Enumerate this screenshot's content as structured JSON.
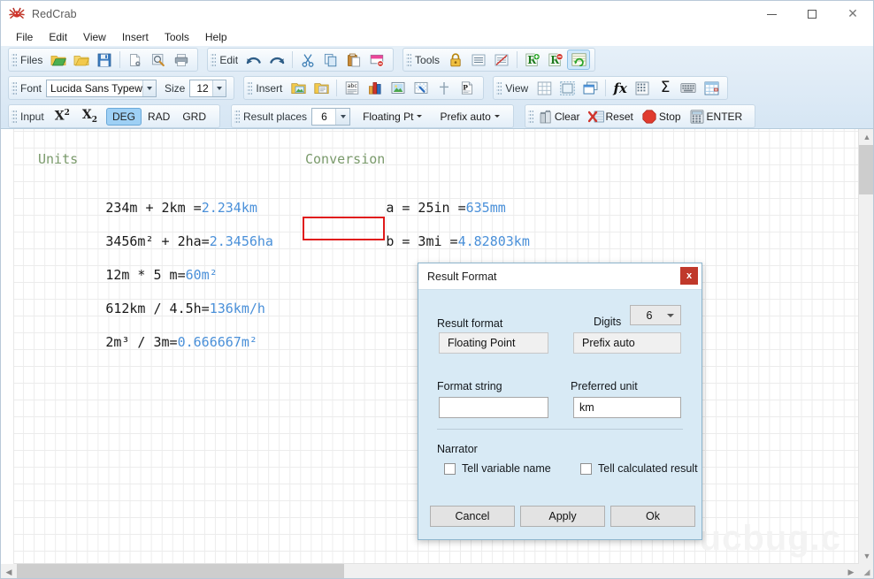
{
  "window": {
    "title": "RedCrab",
    "app_icon": "redcrab-icon",
    "minimize": "minimize-icon",
    "maximize": "maximize-icon",
    "close": "close-icon"
  },
  "menu": {
    "items": [
      "File",
      "Edit",
      "View",
      "Insert",
      "Tools",
      "Help"
    ]
  },
  "toolbars": {
    "files": {
      "label": "Files",
      "buttons": [
        {
          "name": "open-folder-green-icon",
          "glyph": "📂"
        },
        {
          "name": "open-folder-yellow-icon",
          "glyph": "📁"
        },
        {
          "name": "save-icon",
          "glyph": "💾"
        },
        {
          "name": "page-setup-icon",
          "glyph": "📄"
        },
        {
          "name": "print-preview-icon",
          "glyph": "🔍"
        },
        {
          "name": "print-icon",
          "glyph": "🖨"
        }
      ]
    },
    "edit": {
      "label": "Edit",
      "buttons": [
        {
          "name": "undo-icon",
          "glyph": "↶"
        },
        {
          "name": "redo-icon",
          "glyph": "↷"
        },
        {
          "name": "cut-icon",
          "glyph": "✂"
        },
        {
          "name": "copy-icon",
          "glyph": "⧉"
        },
        {
          "name": "paste-icon",
          "glyph": "📋"
        },
        {
          "name": "delete-icon",
          "glyph": "⊖"
        }
      ]
    },
    "tools": {
      "label": "Tools",
      "buttons": [
        {
          "name": "lock-icon",
          "glyph": "🔒"
        },
        {
          "name": "align-lines-icon",
          "glyph": "☰"
        },
        {
          "name": "no-lines-icon",
          "glyph": "⊘"
        },
        {
          "name": "add-result-icon",
          "glyph": "R+"
        },
        {
          "name": "remove-result-icon",
          "glyph": "R-"
        },
        {
          "name": "recalculate-icon",
          "glyph": "↻"
        }
      ]
    },
    "font": {
      "label": "Font",
      "font_value": "Lucida Sans Typewri",
      "size_label": "Size",
      "size_value": "12"
    },
    "insert": {
      "label": "Insert",
      "buttons": [
        {
          "name": "insert-image-icon",
          "glyph": "🖼"
        },
        {
          "name": "insert-document-icon",
          "glyph": "📑"
        },
        {
          "name": "insert-text-icon",
          "glyph": "abc"
        },
        {
          "name": "insert-chart-icon",
          "glyph": "📊"
        },
        {
          "name": "insert-picture-icon",
          "glyph": "🖼"
        },
        {
          "name": "insert-transparent-icon",
          "glyph": "▨"
        },
        {
          "name": "insert-separator-icon",
          "glyph": "┼"
        },
        {
          "name": "insert-pdf-icon",
          "glyph": "P"
        }
      ]
    },
    "view": {
      "label": "View",
      "buttons": [
        {
          "name": "grid-icon",
          "glyph": "⊞"
        },
        {
          "name": "page-border-icon",
          "glyph": "▢"
        },
        {
          "name": "windows-icon",
          "glyph": "⧉"
        },
        {
          "name": "function-icon",
          "glyph": "fx"
        },
        {
          "name": "matrix-icon",
          "glyph": "⌸"
        },
        {
          "name": "sum-icon",
          "glyph": "Σ"
        },
        {
          "name": "keyboard-icon",
          "glyph": "⌨"
        },
        {
          "name": "table-icon",
          "glyph": "▦"
        }
      ]
    },
    "input": {
      "label": "Input",
      "superscript": "X2",
      "subscript": "X2",
      "angle_modes": [
        "DEG",
        "RAD",
        "GRD"
      ],
      "angle_selected": "DEG"
    },
    "result": {
      "places_label": "Result places",
      "places_value": "6",
      "format_label": "Floating Pt",
      "prefix_label": "Prefix auto"
    },
    "actions": {
      "clear": "Clear",
      "reset": "Reset",
      "stop": "Stop",
      "enter": "ENTER",
      "clear_icon": "trash-icon",
      "reset_icon": "reset-red-x-icon",
      "stop_icon": "stop-octagon-icon",
      "enter_icon": "calculator-icon"
    }
  },
  "document": {
    "watermark": "ucbug.c",
    "columns": [
      {
        "name": "units-column",
        "header": "Units",
        "lines": [
          {
            "expr": "234m + 2km =",
            "result": "2.234km"
          },
          {
            "expr": "3456m² + 2ha=",
            "result": "2.3456ha"
          },
          {
            "expr": "12m * 5 m=",
            "result": "60m²"
          },
          {
            "expr": "612km / 4.5h=",
            "result": "136km/h"
          },
          {
            "expr": "2m³ / 3m=",
            "result": "0.666667m²"
          }
        ]
      },
      {
        "name": "conversion-column",
        "header": "Conversion",
        "lines": [
          {
            "expr": "a = 25in =",
            "result": "635mm",
            "selected": false
          },
          {
            "expr": "b = 3mi =",
            "result": "4.82803km",
            "selected": true
          }
        ]
      }
    ]
  },
  "dialog": {
    "title": "Result Format",
    "close_label": "x",
    "result_format_label": "Result format",
    "result_format_value": "Floating Point",
    "digits_label": "Digits",
    "digits_value": "6",
    "prefix_value": "Prefix auto",
    "format_string_label": "Format string",
    "format_string_value": "",
    "format_string_placeholder": "",
    "preferred_unit_label": "Preferred unit",
    "preferred_unit_value": "km",
    "narrator_label": "Narrator",
    "tell_variable_name": "Tell variable name",
    "tell_calculated_result": "Tell calculated result",
    "cancel": "Cancel",
    "apply": "Apply",
    "ok": "Ok"
  },
  "colors": {
    "accent_blue": "#4a90d9",
    "header_green": "#7a9a6b",
    "selection_red": "#e01b1b",
    "dialog_bg": "#d8eaf5",
    "toolbar_bg": "#dfebf6"
  }
}
